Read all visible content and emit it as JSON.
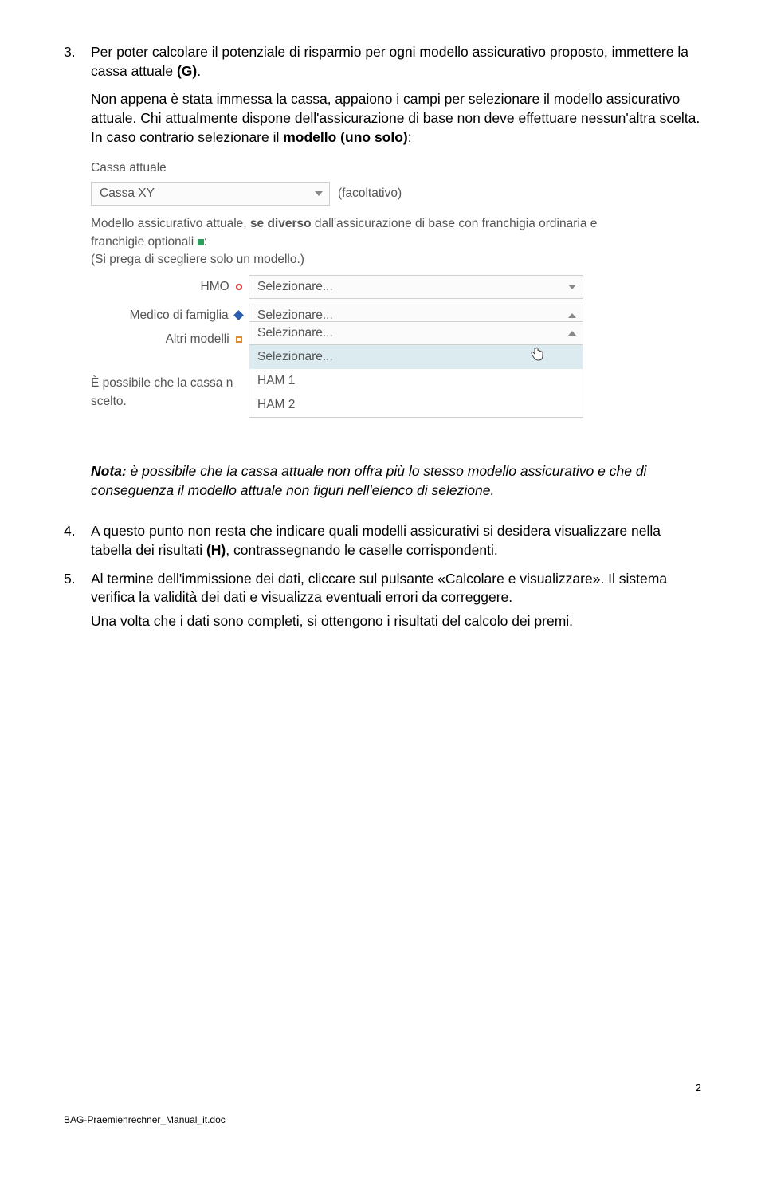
{
  "items": {
    "n3": {
      "num": "3.",
      "p1a": "Per poter calcolare il potenziale di risparmio per ogni modello assicurativo proposto, immettere la cassa attuale ",
      "p1b": "(G)",
      "p1c": ".",
      "p2a": "Non appena è stata immessa la cassa, appaiono i campi per selezionare il modello assicurativo attuale. Chi attualmente dispone dell'assicurazione di base non deve effettuare nessun'altra scelta. In caso contrario selezionare il ",
      "p2b": "modello (uno solo)",
      "p2c": ":"
    },
    "note": {
      "label": "Nota:",
      "text": " è possibile che la cassa attuale non offra più lo stesso modello assicurativo e che di conseguenza il modello attuale non figuri nell'elenco di selezione."
    },
    "n4": {
      "num": "4.",
      "a": "A questo punto non resta che indicare quali modelli assicurativi si desidera visualizzare nella tabella dei risultati ",
      "b": "(H)",
      "c": ", contrassegnando le caselle corrispondenti."
    },
    "n5": {
      "num": "5.",
      "a": "Al termine dell'immissione dei dati, cliccare sul pulsante «Calcolare e visualizzare». Il sistema verifica la validità dei dati e visualizza eventuali errori da correggere.",
      "b": "Una volta che i dati sono completi, si ottengono i risultati del calcolo dei premi."
    }
  },
  "form": {
    "title": "Cassa attuale",
    "cassa_value": "Cassa XY",
    "facoltativo": "(facoltativo)",
    "descr_a": "Modello assicurativo attuale, ",
    "descr_b": "se diverso",
    "descr_c": " dall'assicurazione di base con franchigia ordinaria e franchigie optionali ",
    "descr_d": ":",
    "small": "(Si prega di scegliere solo un modello.)",
    "hmo": "HMO",
    "medico": "Medico di famiglia",
    "altri": "Altri modelli",
    "placeholder": "Selezionare...",
    "dd_sel": "Selezionare...",
    "dd_o1": "HAM 1",
    "dd_o2": "HAM 2",
    "trunc1": "È possibile che la cassa n",
    "trunc2": "scelto."
  },
  "footer": {
    "pagenum": "2",
    "docname": "BAG-Praemienrechner_Manual_it.doc"
  }
}
